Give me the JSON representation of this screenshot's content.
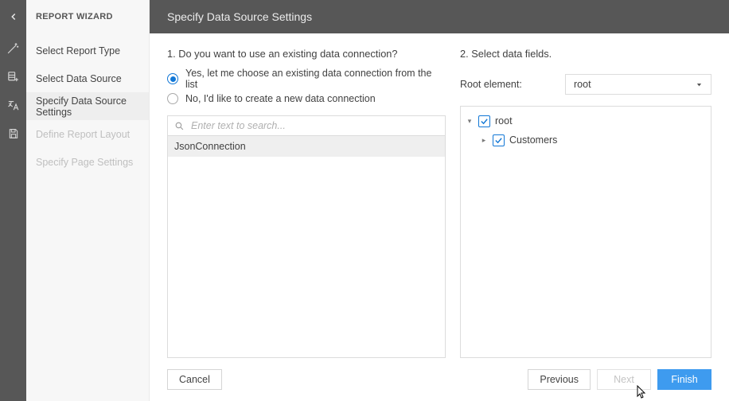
{
  "sidebar": {
    "title": "REPORT WIZARD",
    "items": [
      {
        "label": "Select Report Type",
        "active": false,
        "disabled": false
      },
      {
        "label": "Select Data Source",
        "active": false,
        "disabled": false
      },
      {
        "label": "Specify Data Source Settings",
        "active": true,
        "disabled": false
      },
      {
        "label": "Define Report Layout",
        "active": false,
        "disabled": true
      },
      {
        "label": "Specify Page Settings",
        "active": false,
        "disabled": true
      }
    ]
  },
  "header": {
    "title": "Specify Data Source Settings"
  },
  "questions": {
    "q1": "1. Do you want to use an existing data connection?",
    "q2": "2. Select data fields."
  },
  "radios": {
    "opt1": "Yes, let me choose an existing data connection from the list",
    "opt2": "No, I'd like to create a new data connection",
    "selected": "opt1"
  },
  "search": {
    "placeholder": "Enter text to search..."
  },
  "connections": [
    "JsonConnection"
  ],
  "rootElement": {
    "label": "Root element:",
    "value": "root"
  },
  "tree": [
    {
      "level": 0,
      "label": "root",
      "checked": true,
      "toggle": "▾"
    },
    {
      "level": 1,
      "label": "Customers",
      "checked": true,
      "toggle": "▸"
    }
  ],
  "buttons": {
    "cancel": "Cancel",
    "previous": "Previous",
    "next": "Next",
    "finish": "Finish"
  },
  "icons": {
    "back": "back-chevron",
    "rail1": "magic-wand",
    "rail2": "database-add",
    "rail3": "localize",
    "rail4": "save"
  }
}
